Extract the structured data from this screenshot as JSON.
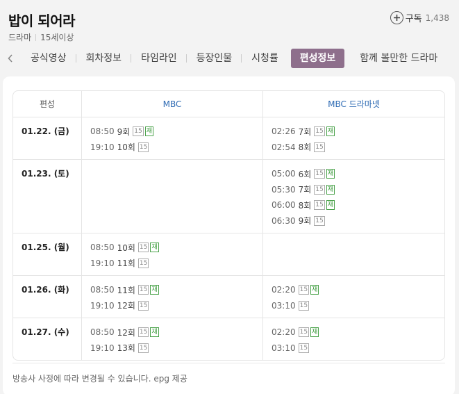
{
  "header": {
    "title": "밥이 되어라",
    "genre": "드라마",
    "rating": "15세이상",
    "subscribe_label": "구독",
    "subscribe_count": "1,438"
  },
  "tabs": [
    "공식영상",
    "회차정보",
    "타임라인",
    "등장인물",
    "시청률",
    "편성정보",
    "함께 볼만한 드라마"
  ],
  "active_tab": "편성정보",
  "table": {
    "headers": [
      "편성",
      "MBC",
      "MBC 드라마넷"
    ],
    "rows": [
      {
        "date": "01.22. (금)",
        "mbc": [
          {
            "time": "08:50",
            "ep": "9회",
            "rating": "15",
            "re": "재"
          },
          {
            "time": "19:10",
            "ep": "10회",
            "rating": "15",
            "re": ""
          }
        ],
        "net": [
          {
            "time": "02:26",
            "ep": "7회",
            "rating": "15",
            "re": "재"
          },
          {
            "time": "02:54",
            "ep": "8회",
            "rating": "15",
            "re": ""
          }
        ]
      },
      {
        "date": "01.23. (토)",
        "mbc": [],
        "net": [
          {
            "time": "05:00",
            "ep": "6회",
            "rating": "15",
            "re": "재"
          },
          {
            "time": "05:30",
            "ep": "7회",
            "rating": "15",
            "re": "재"
          },
          {
            "time": "06:00",
            "ep": "8회",
            "rating": "15",
            "re": "재"
          },
          {
            "time": "06:30",
            "ep": "9회",
            "rating": "15",
            "re": ""
          }
        ]
      },
      {
        "date": "01.25. (월)",
        "mbc": [
          {
            "time": "08:50",
            "ep": "10회",
            "rating": "15",
            "re": "재"
          },
          {
            "time": "19:10",
            "ep": "11회",
            "rating": "15",
            "re": ""
          }
        ],
        "net": []
      },
      {
        "date": "01.26. (화)",
        "mbc": [
          {
            "time": "08:50",
            "ep": "11회",
            "rating": "15",
            "re": "재"
          },
          {
            "time": "19:10",
            "ep": "12회",
            "rating": "15",
            "re": ""
          }
        ],
        "net": [
          {
            "time": "02:20",
            "ep": "",
            "rating": "15",
            "re": "재"
          },
          {
            "time": "03:10",
            "ep": "",
            "rating": "15",
            "re": ""
          }
        ]
      },
      {
        "date": "01.27. (수)",
        "mbc": [
          {
            "time": "08:50",
            "ep": "12회",
            "rating": "15",
            "re": "재"
          },
          {
            "time": "19:10",
            "ep": "13회",
            "rating": "15",
            "re": ""
          }
        ],
        "net": [
          {
            "time": "02:20",
            "ep": "",
            "rating": "15",
            "re": "재"
          },
          {
            "time": "03:10",
            "ep": "",
            "rating": "15",
            "re": ""
          }
        ]
      }
    ]
  },
  "footer_note": "방송사 사정에 따라 변경될 수 있습니다. epg 제공",
  "colors": {
    "active_tab_bg": "#8e6f8c",
    "channel_header": "#2d6ab3",
    "rerun_badge": "#3a9a3a"
  }
}
